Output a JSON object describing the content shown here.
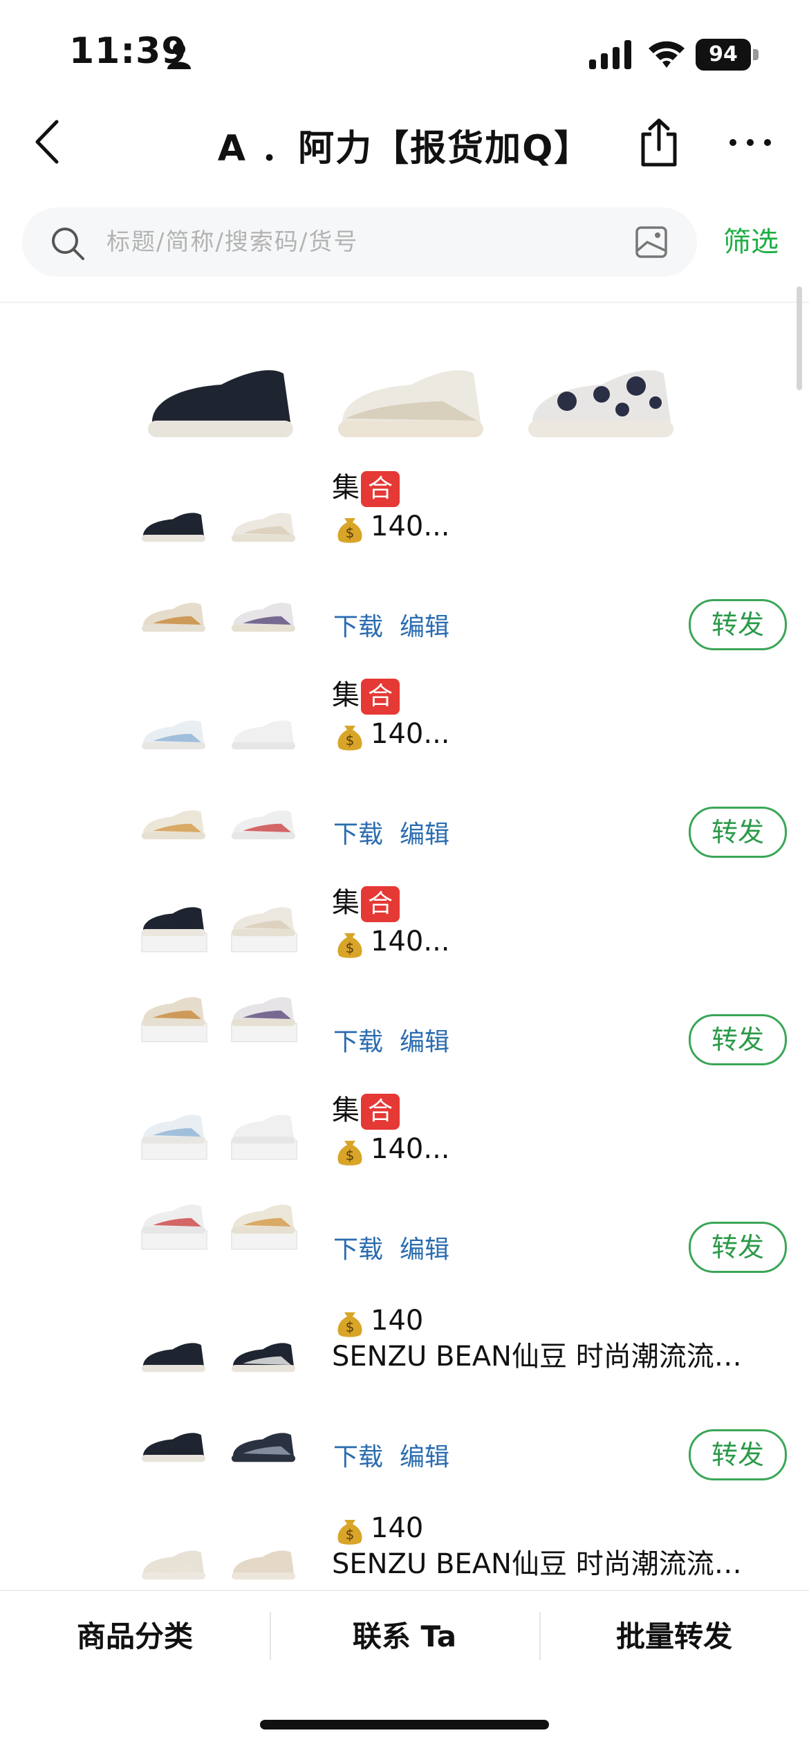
{
  "status_bar": {
    "time": "11:39",
    "battery": "94"
  },
  "nav": {
    "title": "A ．阿力【报货加Q】"
  },
  "search": {
    "placeholder": "标题/简称/搜索码/货号",
    "filter_label": "筛选"
  },
  "items": [
    {
      "title": "集",
      "tag_emoji": "合",
      "price": "140...",
      "download_label": "下载",
      "edit_label": "编辑",
      "forward_label": "转发"
    },
    {
      "title": "集",
      "tag_emoji": "合",
      "price": "140...",
      "download_label": "下载",
      "edit_label": "编辑",
      "forward_label": "转发"
    },
    {
      "title": "集",
      "tag_emoji": "合",
      "price": "140...",
      "download_label": "下载",
      "edit_label": "编辑",
      "forward_label": "转发"
    },
    {
      "title": "集",
      "tag_emoji": "合",
      "price": "140...",
      "download_label": "下载",
      "edit_label": "编辑",
      "forward_label": "转发"
    },
    {
      "price": "140",
      "description": "SENZU BEAN仙豆 时尚潮流流…",
      "download_label": "下载",
      "edit_label": "编辑",
      "forward_label": "转发"
    },
    {
      "price": "140",
      "description": "SENZU BEAN仙豆 时尚潮流流…"
    }
  ],
  "bottom_tabs": [
    {
      "label": "商品分类"
    },
    {
      "label": "联系 Ta"
    },
    {
      "label": "批量转发"
    }
  ],
  "colors": {
    "accent_green": "#1fae45",
    "link_blue": "#2a6cb0",
    "tag_red": "#e53935"
  },
  "icons": [
    "person-icon",
    "signal-icon",
    "wifi-icon",
    "back-chevron-icon",
    "share-icon",
    "more-icon",
    "search-icon",
    "image-search-icon",
    "moneybag-icon"
  ]
}
